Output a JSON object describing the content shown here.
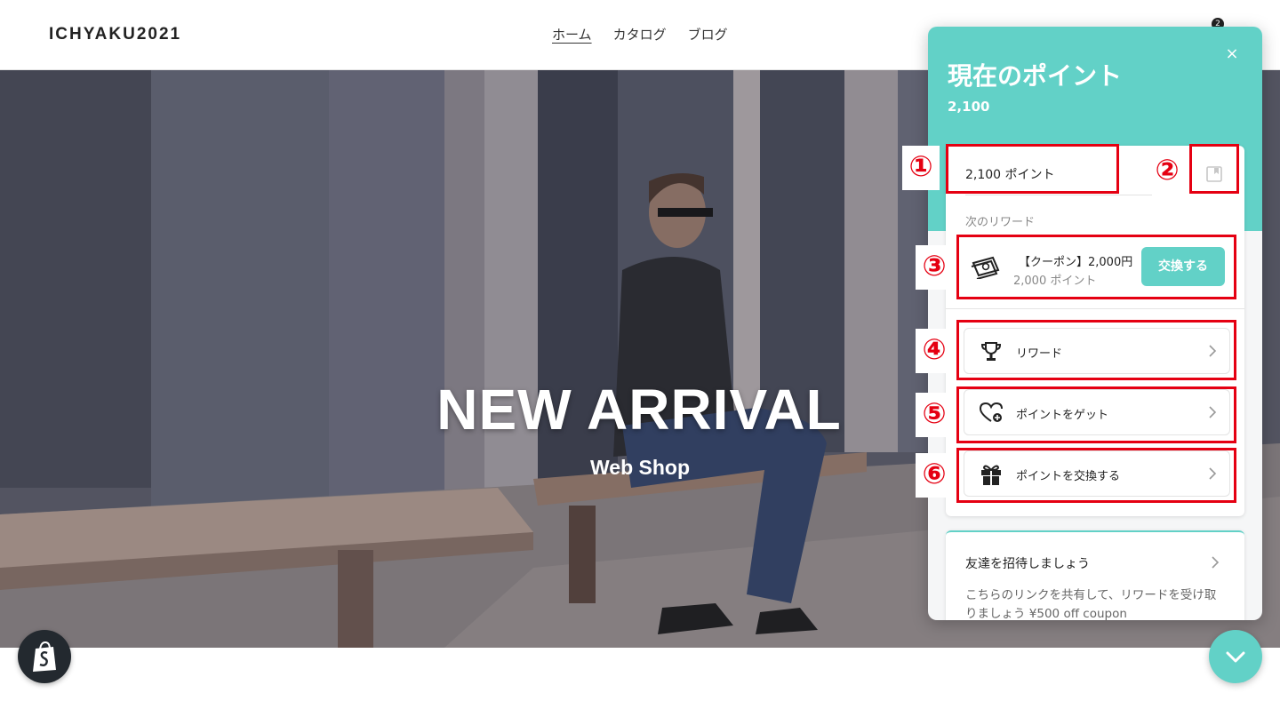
{
  "header": {
    "logo": "ICHYAKU2021",
    "nav": [
      {
        "label": "ホーム",
        "active": true
      },
      {
        "label": "カタログ",
        "active": false
      },
      {
        "label": "ブログ",
        "active": false
      }
    ],
    "cart_count": "2"
  },
  "hero": {
    "title": "NEW ARRIVAL",
    "subtitle": "Web Shop"
  },
  "widget": {
    "title": "現在のポイント",
    "points": "2,100",
    "points_field": "2,100 ポイント",
    "next_reward_label": "次のリワード",
    "reward": {
      "name": "【クーポン】2,000円",
      "cost": "2,000 ポイント",
      "button": "交換する"
    },
    "menu": [
      {
        "label": "リワード",
        "icon": "trophy-icon"
      },
      {
        "label": "ポイントをゲット",
        "icon": "heart-plus-icon"
      },
      {
        "label": "ポイントを交換する",
        "icon": "gift-icon"
      }
    ],
    "invite": {
      "title": "友達を招待しましょう",
      "description": "こちらのリンクを共有して、リワードを受け取りましょう ¥500 off coupon"
    }
  },
  "annotations": [
    "①",
    "②",
    "③",
    "④",
    "⑤",
    "⑥"
  ],
  "colors": {
    "accent": "#62d1c7",
    "annotation_red": "#e50012",
    "header_text": "#222222"
  }
}
